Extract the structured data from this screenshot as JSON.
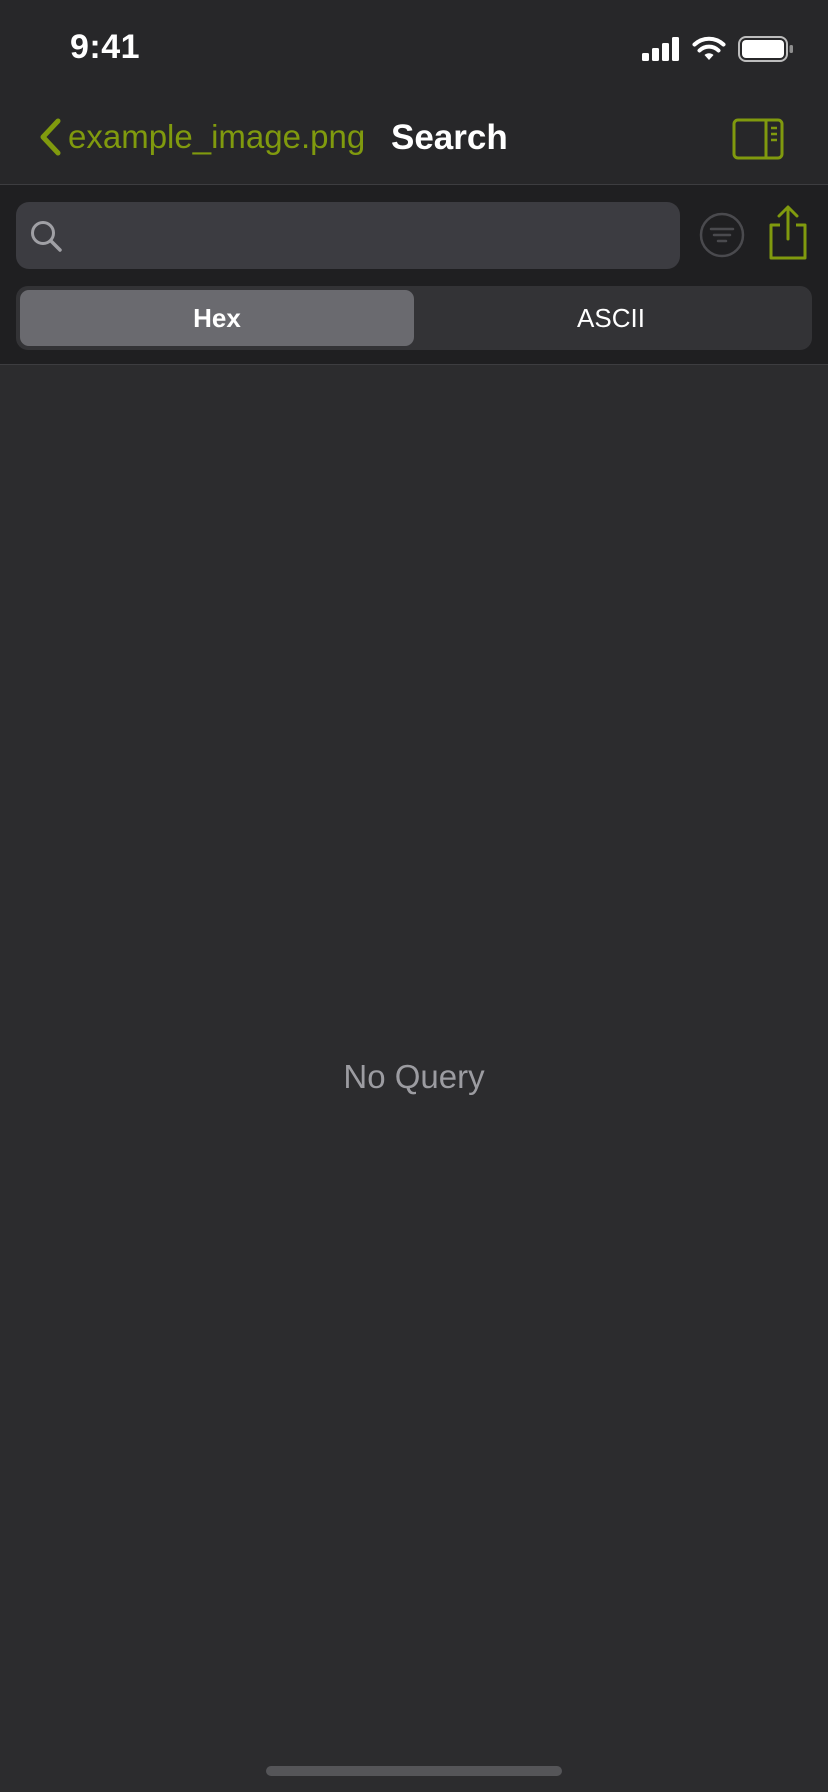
{
  "colors": {
    "accent": "#809a0e",
    "background": "#2c2c2e",
    "bar_background": "#272729",
    "muted_text": "#9c9ca1"
  },
  "status_bar": {
    "time": "9:41",
    "icons": [
      "cellular-signal-icon",
      "wifi-icon",
      "battery-icon"
    ]
  },
  "nav": {
    "back_label": "example_image.png",
    "title": "Search",
    "right_icon": "sidebar-toggle-icon"
  },
  "search": {
    "value": "",
    "placeholder": "",
    "filter_icon": "filter-icon",
    "share_icon": "share-icon"
  },
  "segments": [
    {
      "label": "Hex",
      "selected": true
    },
    {
      "label": "ASCII",
      "selected": false
    }
  ],
  "main": {
    "empty_message": "No Query"
  }
}
